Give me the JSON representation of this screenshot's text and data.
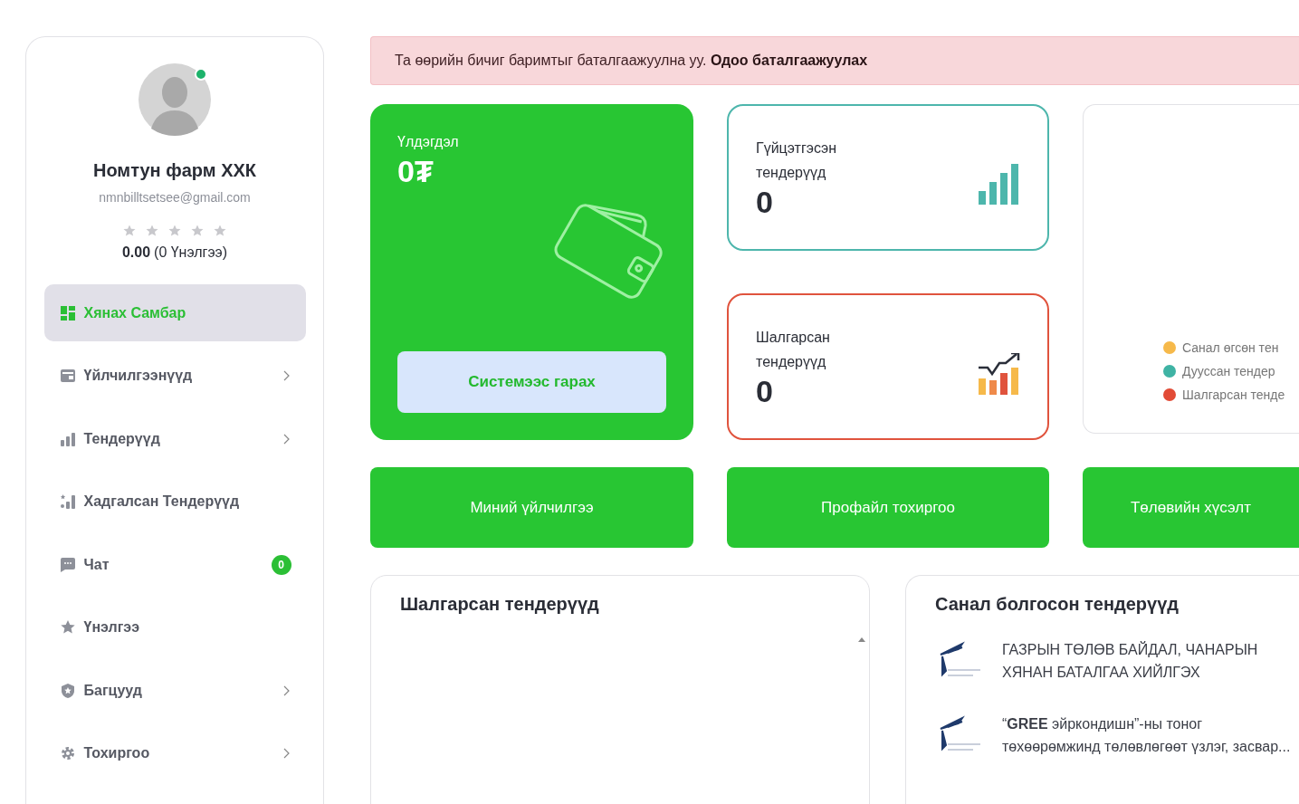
{
  "alert": {
    "text": "Та өөрийн бичиг баримтыг баталгаажуулна уу.",
    "link": "Одоо баталгаажуулах"
  },
  "profile": {
    "name": "Номтун фарм ХХК",
    "email": "nmnbilltsetsee@gmail.com",
    "online": true,
    "stars": 0,
    "rating": "0.00",
    "reviews": "(0 Үнэлгээ)"
  },
  "nav": [
    {
      "label": "Хянах Самбар",
      "selected": true,
      "expandable": false
    },
    {
      "label": "Үйлчилгээнүүд",
      "selected": false,
      "expandable": true
    },
    {
      "label": "Тендерүүд",
      "selected": false,
      "expandable": true
    },
    {
      "label": "Хадгалсан Тендерүүд",
      "selected": false,
      "expandable": false
    },
    {
      "label": "Чат",
      "selected": false,
      "expandable": false,
      "badge": "0"
    },
    {
      "label": "Үнэлгээ",
      "selected": false,
      "expandable": false
    },
    {
      "label": "Багцууд",
      "selected": false,
      "expandable": true
    },
    {
      "label": "Тохиргоо",
      "selected": false,
      "expandable": true
    }
  ],
  "balance": {
    "label": "Үлдэгдэл",
    "value": "0₮",
    "button": "Системээс гарах"
  },
  "stat_cards": [
    {
      "kind": "bars",
      "label": "Гүйцэтгэсэн тендерүүд",
      "value": "0",
      "color": "#4db6ac"
    },
    {
      "kind": "trend",
      "label": "Шалгарсан тендерүүд",
      "value": "0",
      "color": "#e0533d"
    }
  ],
  "legend": [
    {
      "label": "Санал өгсөн тен",
      "color": "#f6b94a"
    },
    {
      "label": "Дууссан тендер",
      "color": "#3fb3a4"
    },
    {
      "label": "Шалгарсан тенде",
      "color": "#e24b36"
    }
  ],
  "actions": [
    "Миний үйлчилгээ",
    "Профайл тохиргоо",
    "Төлөвийн хүсэлт"
  ],
  "panels": [
    {
      "title": "Шалгарсан тендерүүд"
    },
    {
      "title": "Санал болгосон тендерүүд",
      "items": [
        {
          "text": "ГАЗРЫН ТӨЛӨВ БАЙДАЛ, ЧАНАРЫН ХЯНАН БАТАЛГАА ХИЙЛГЭХ"
        },
        {
          "text": "“**GREE** эйркондишн”-ны тоног төхөөрөмжинд төлөвлөгөөт үзлэг, засвар..."
        }
      ]
    }
  ]
}
